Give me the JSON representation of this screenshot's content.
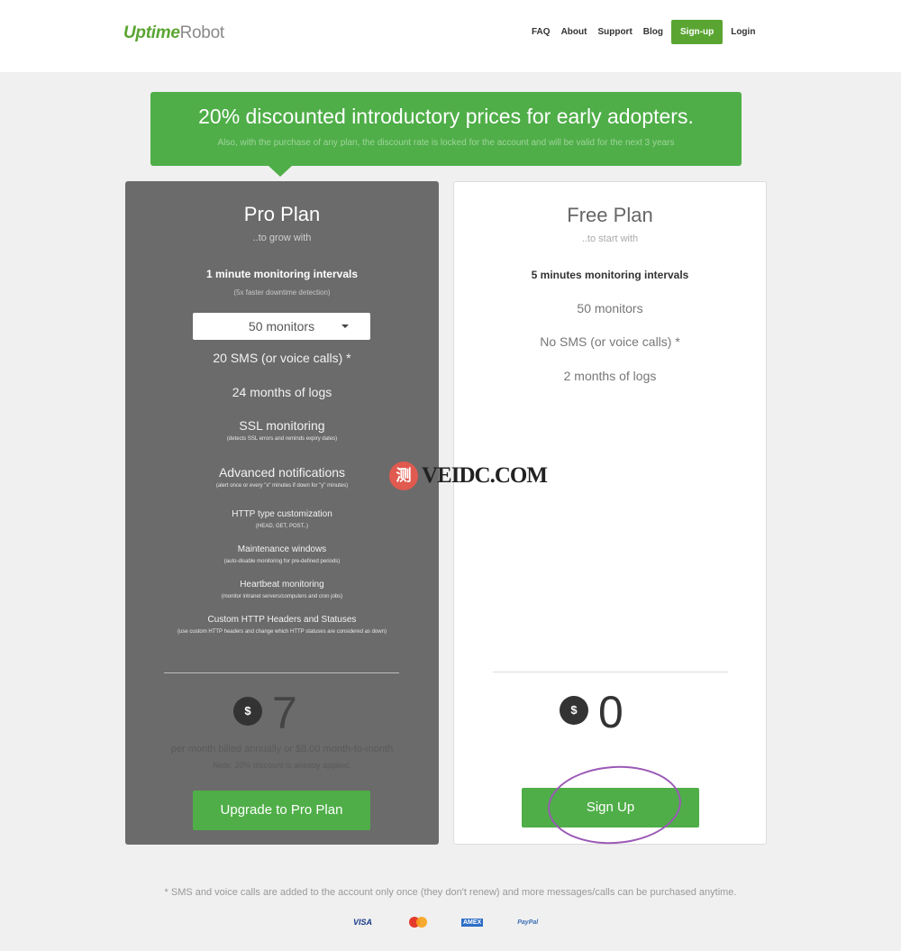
{
  "header": {
    "logo_main": "Uptime",
    "logo_accent": "Robot",
    "nav": {
      "faq": "FAQ",
      "about": "About",
      "support": "Support",
      "blog": "Blog",
      "signup": "Sign-up",
      "login": "Login"
    }
  },
  "promo": {
    "title": "20% discounted introductory prices for early adopters.",
    "subtitle": "Also, with the purchase of any plan, the discount rate is locked for the account and will be valid for the next 3 years"
  },
  "pro": {
    "title": "Pro Plan",
    "subtitle": "..to grow with",
    "interval": "1 minute monitoring intervals",
    "interval_note": "(5x faster downtime detection)",
    "monitors_selected": "50 monitors",
    "sms": "20 SMS (or voice calls) *",
    "logs": "24 months of logs",
    "ssl": "SSL monitoring",
    "ssl_note": "(detects SSL errors and reminds expiry dates)",
    "notifications": "Advanced notifications",
    "notifications_note": "(alert once or every \"x\" minutes if down for \"y\" minutes)",
    "http": "HTTP type customization",
    "http_note": "(HEAD, GET, POST..)",
    "maintenance": "Maintenance windows",
    "maintenance_note": "(auto-disable monitoring for pre-defined periods)",
    "heartbeat": "Heartbeat monitoring",
    "heartbeat_note": "(monitor intranet servers/computers and cron jobs)",
    "headers": "Custom HTTP Headers and Statuses",
    "headers_note": "(use custom HTTP headers and change which HTTP statuses are considered as down)",
    "currency": "$",
    "price": "7",
    "price_note": "per month billed annually or $8.00 month-to-month",
    "discount_note": "Note: 20% discount is already applied.",
    "button": "Upgrade to Pro Plan"
  },
  "free": {
    "title": "Free Plan",
    "subtitle": "..to start with",
    "interval": "5 minutes monitoring intervals",
    "monitors": "50 monitors",
    "sms": "No SMS (or voice calls) *",
    "logs": "2 months of logs",
    "currency": "$",
    "price": "0",
    "button": "Sign Up"
  },
  "watermark": {
    "badge": "测",
    "text": "VEIDC.COM"
  },
  "footnote": "* SMS and voice calls are added to the account only once (they don't renew) and more messages/calls can be purchased anytime.",
  "payments": {
    "visa": "VISA",
    "amex": "AMEX",
    "paypal": "PayPal"
  },
  "colors": {
    "brand_green": "#4fae48",
    "pro_card": "#6b6b6b",
    "annotation_circle": "#9b59b6"
  }
}
